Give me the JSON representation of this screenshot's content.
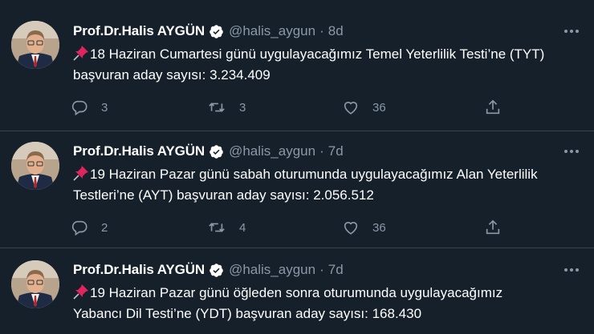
{
  "tweets": [
    {
      "author_name": "Prof.Dr.Halis AYGÜN",
      "handle": "@halis_aygun",
      "separator": "·",
      "time": "8d",
      "text": "18 Haziran Cumartesi günü uygulayacağımız Temel Yeterlilik Testi’ne (TYT) başvuran aday sayısı: 3.234.409",
      "replies": "3",
      "retweets": "3",
      "likes": "36"
    },
    {
      "author_name": "Prof.Dr.Halis AYGÜN",
      "handle": "@halis_aygun",
      "separator": "·",
      "time": "7d",
      "text": "19 Haziran Pazar günü sabah oturumunda uygulayacağımız Alan Yeterlilik Testleri’ne (AYT) başvuran aday sayısı: 2.056.512",
      "replies": "2",
      "retweets": "4",
      "likes": "36"
    },
    {
      "author_name": "Prof.Dr.Halis AYGÜN",
      "handle": "@halis_aygun",
      "separator": "·",
      "time": "7d",
      "text": "19 Haziran Pazar günü öğleden sonra oturumunda uygulayacağımız Yabancı Dil Testi’ne (YDT) başvuran aday sayısı: 168.430",
      "replies": "",
      "retweets": "",
      "likes": ""
    }
  ],
  "icons": {
    "verified": "verified-badge-icon",
    "pin": "pushpin-icon",
    "more": "more-icon",
    "reply": "reply-icon",
    "retweet": "retweet-icon",
    "like": "heart-icon",
    "share": "share-icon"
  },
  "colors": {
    "background": "#15202b",
    "divider": "#38444d",
    "secondary_text": "#8b98a5",
    "verified": "#ffffff",
    "pin": "#e0245e"
  }
}
